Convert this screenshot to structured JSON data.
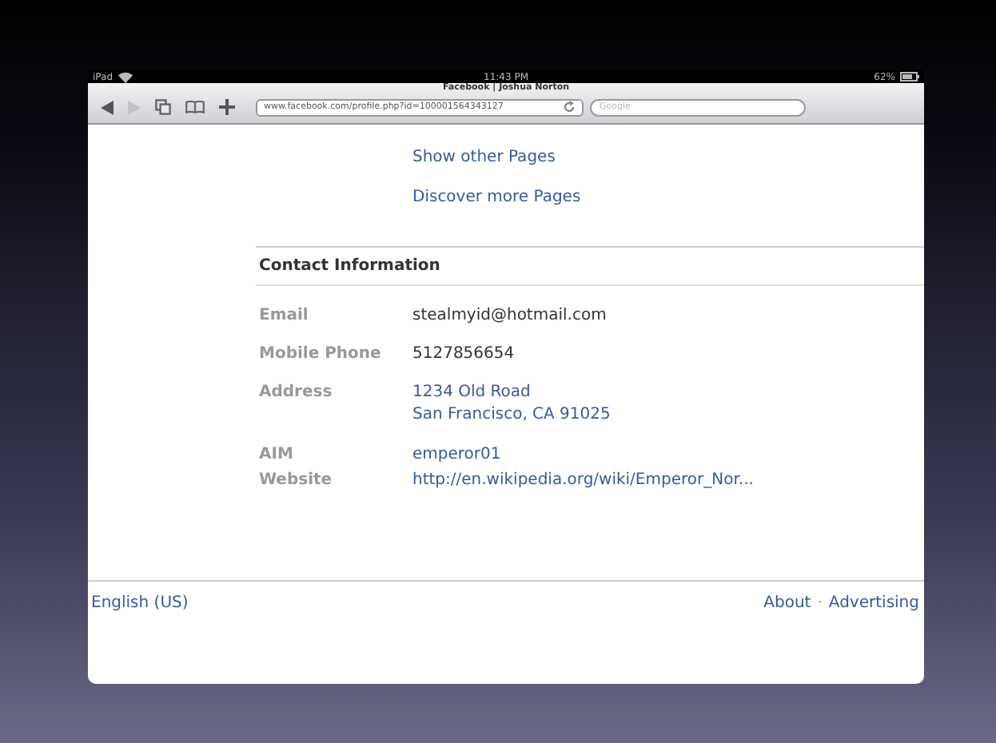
{
  "status_bar": {
    "carrier": "iPad",
    "time": "11:43 PM",
    "battery": "62%"
  },
  "browser": {
    "title": "Facebook | Joshua Norton",
    "url": "www.facebook.com/profile.php?id=100001564343127",
    "search_placeholder": "Google",
    "nav": [
      {
        "kind": "back",
        "disabled": false
      },
      {
        "kind": "forward",
        "disabled": true
      }
    ]
  },
  "page_links": [
    "Show other Pages",
    "Discover more Pages"
  ],
  "contact": {
    "heading": "Contact Information",
    "rows": [
      {
        "label": "Email",
        "kind": "text",
        "values": [
          "stealmyid@hotmail.com"
        ]
      },
      {
        "label": "Mobile Phone",
        "kind": "text",
        "values": [
          "5127856654"
        ]
      },
      {
        "label": "Address",
        "kind": "link",
        "values": [
          "1234 Old Road",
          "San Francisco, CA 91025"
        ]
      },
      {
        "label": "AIM",
        "kind": "link",
        "values": [
          "emperor01"
        ]
      },
      {
        "label": "Website",
        "kind": "link",
        "values": [
          "http://en.wikipedia.org/wiki/Emperor_Nor..."
        ]
      }
    ]
  },
  "footer": {
    "language": "English (US)",
    "links": [
      "About",
      "Advertising"
    ],
    "separator": "·"
  }
}
